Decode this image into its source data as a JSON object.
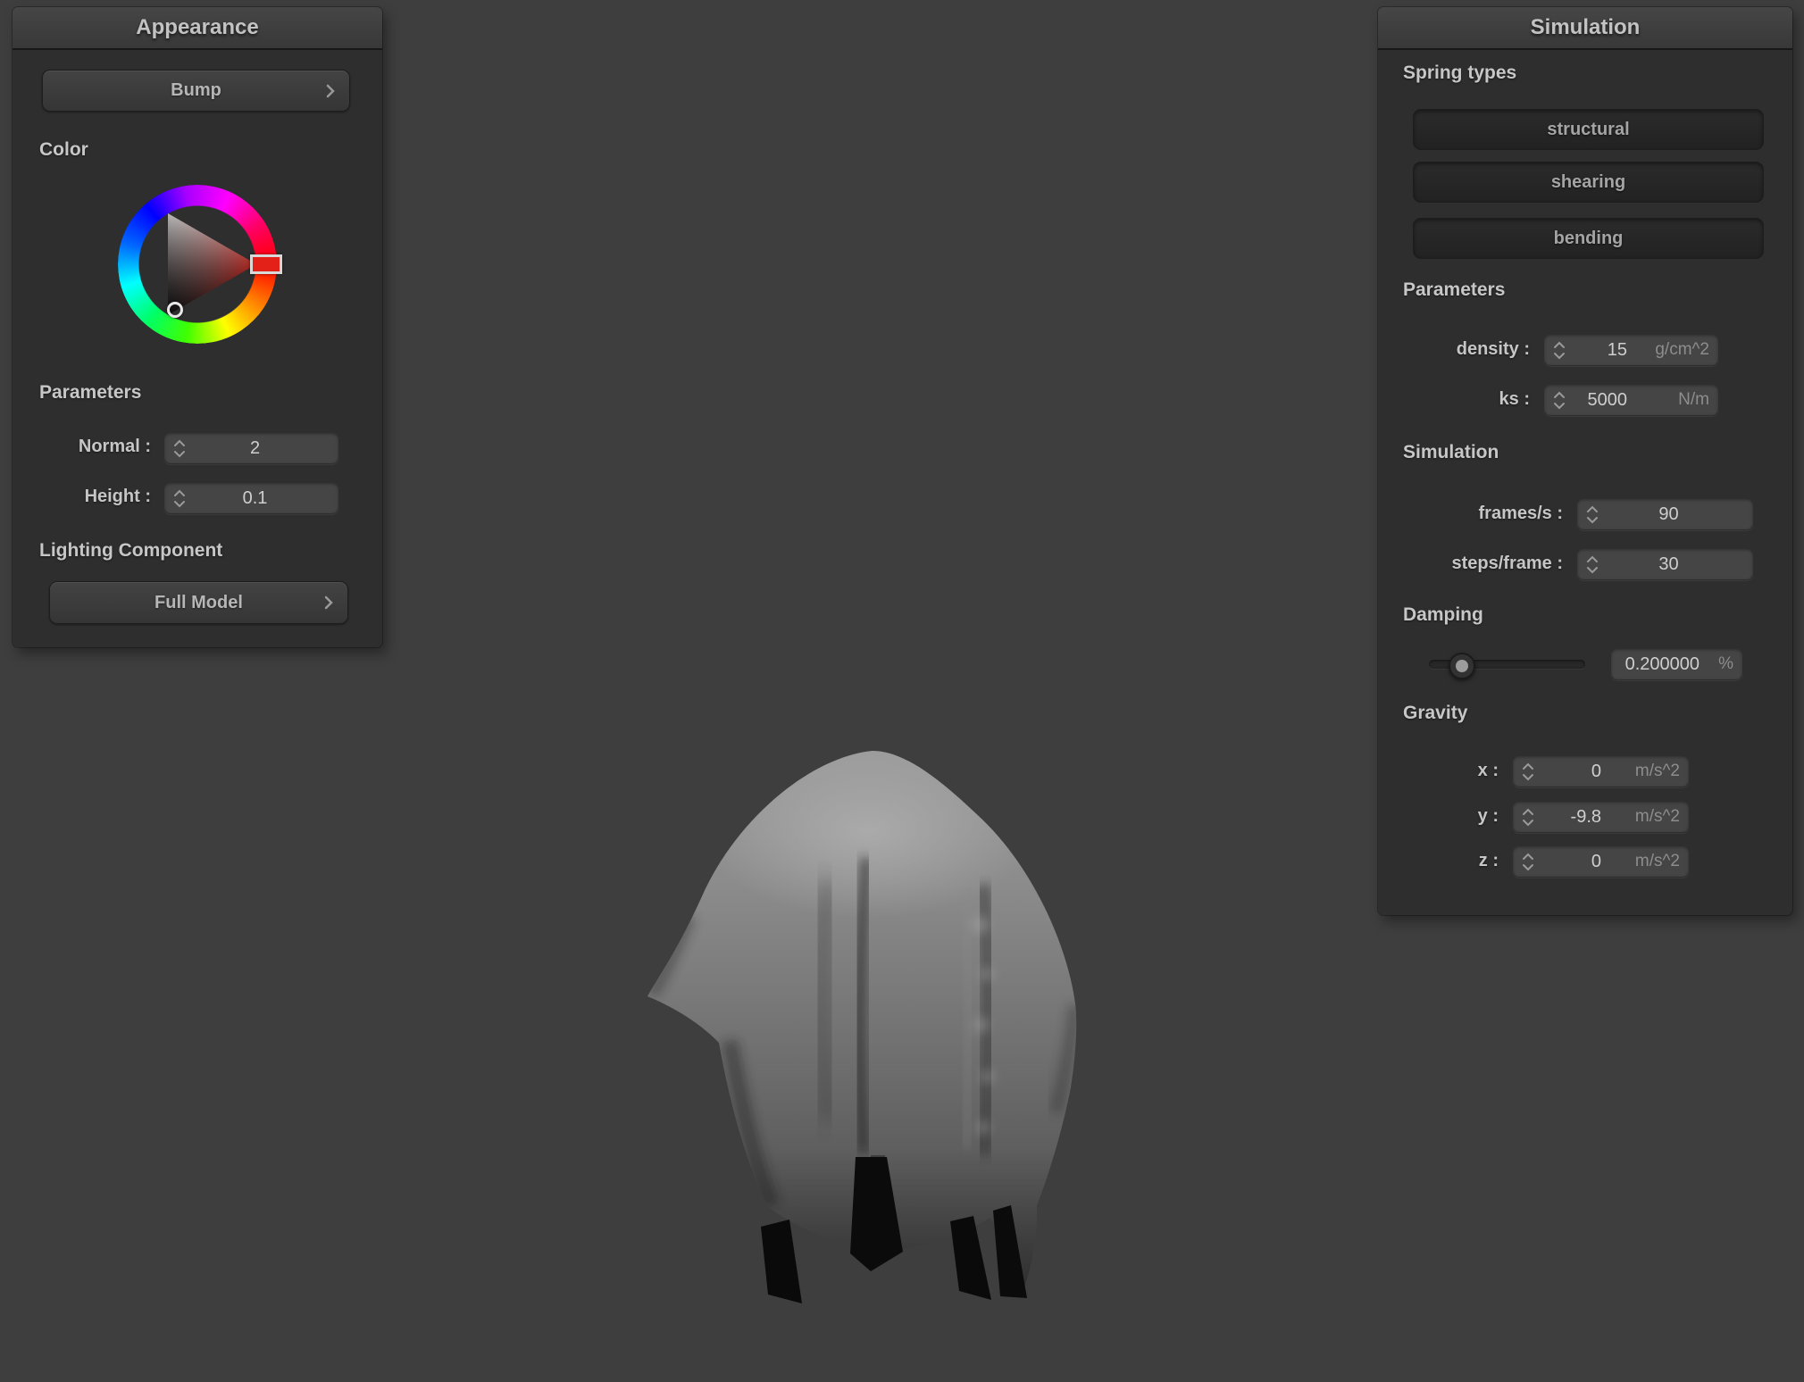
{
  "appearance_panel": {
    "title": "Appearance",
    "bump_button": {
      "label": "Bump"
    },
    "color_label": "Color",
    "parameters_label": "Parameters",
    "rows": [
      {
        "label": "Normal :",
        "value": "2"
      },
      {
        "label": "Height :",
        "value": "0.1"
      }
    ],
    "lighting_label": "Lighting Component",
    "lighting_button": {
      "label": "Full Model"
    }
  },
  "simulation_panel": {
    "title": "Simulation",
    "spring_types_label": "Spring types",
    "spring_buttons": [
      {
        "label": "structural"
      },
      {
        "label": "shearing"
      },
      {
        "label": "bending"
      }
    ],
    "parameters_label": "Parameters",
    "parameter_rows": [
      {
        "label": "density :",
        "value": "15",
        "unit": "g/cm^2"
      },
      {
        "label": "ks :",
        "value": "5000",
        "unit": "N/m"
      }
    ],
    "simulation_label": "Simulation",
    "simulation_rows": [
      {
        "label": "frames/s :",
        "value": "90"
      },
      {
        "label": "steps/frame :",
        "value": "30"
      }
    ],
    "damping_label": "Damping",
    "damping": {
      "value": "0.200000",
      "unit": "%",
      "slider_pos": 0.2
    },
    "gravity_label": "Gravity",
    "gravity_rows": [
      {
        "label": "x :",
        "value": "0",
        "unit": "m/s^2"
      },
      {
        "label": "y :",
        "value": "-9.8",
        "unit": "m/s^2"
      },
      {
        "label": "z :",
        "value": "0",
        "unit": "m/s^2"
      }
    ]
  },
  "colors": {
    "background": "#3e3e3e",
    "panel": "#2e2e2e",
    "selected_hue": "#e32119"
  }
}
